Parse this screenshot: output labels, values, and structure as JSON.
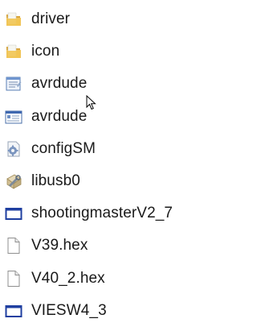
{
  "files": [
    {
      "name": "driver",
      "icon": "folder-icon"
    },
    {
      "name": "icon",
      "icon": "folder-icon"
    },
    {
      "name": "avrdude",
      "icon": "config-settings-icon"
    },
    {
      "name": "avrdude",
      "icon": "application-window-icon"
    },
    {
      "name": "configSM",
      "icon": "gear-file-icon"
    },
    {
      "name": "libusb0",
      "icon": "dll-wrench-icon"
    },
    {
      "name": "shootingmasterV2_7",
      "icon": "program-window-icon"
    },
    {
      "name": "V39.hex",
      "icon": "blank-file-icon"
    },
    {
      "name": "V40_2.hex",
      "icon": "blank-file-icon"
    },
    {
      "name": "VIESW4_3",
      "icon": "program-window-icon"
    }
  ],
  "colors": {
    "folder": "#e9b949",
    "folder_dark": "#c8952a",
    "window_border": "#1f3fa0",
    "text": "#1a1a1a"
  }
}
